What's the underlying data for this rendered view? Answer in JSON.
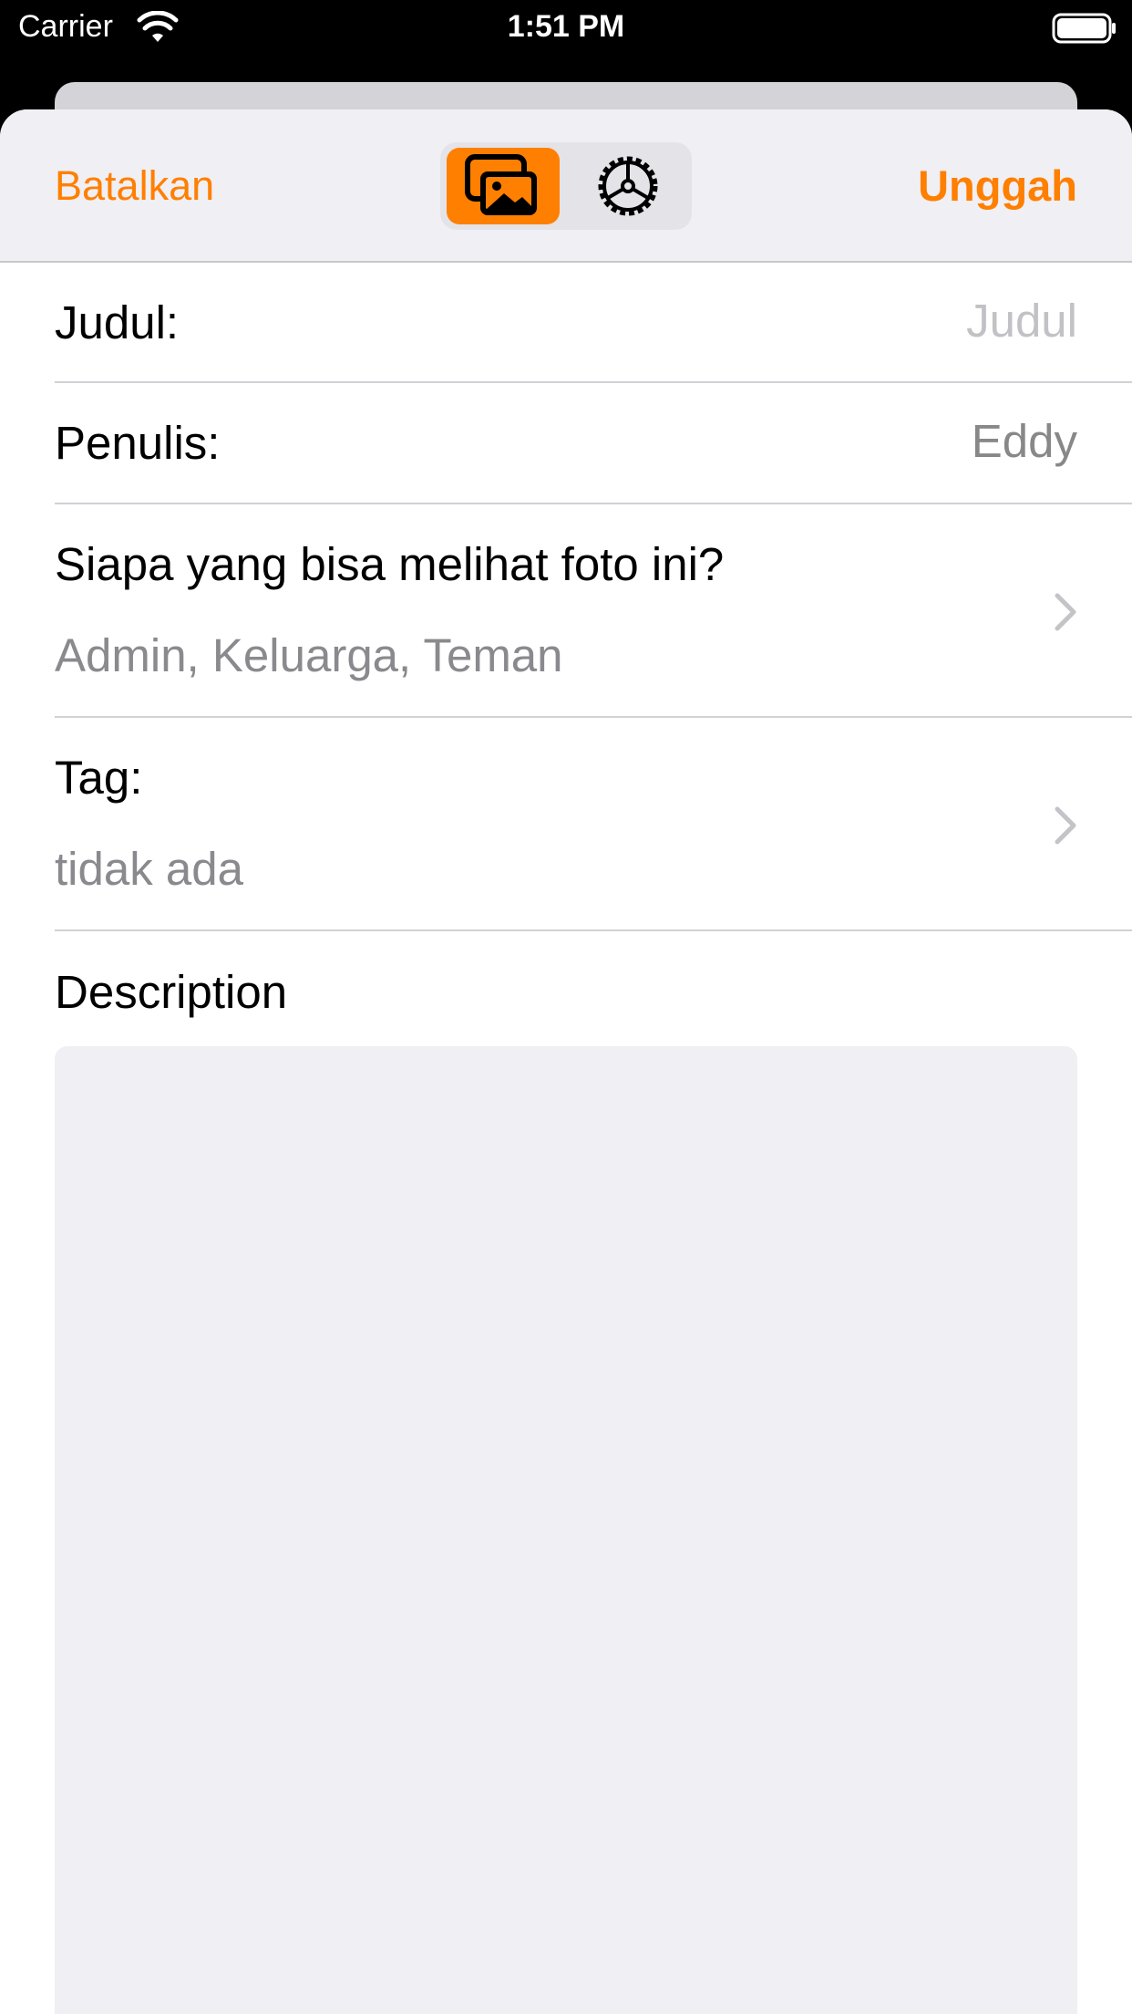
{
  "status_bar": {
    "carrier": "Carrier",
    "time": "1:51 PM",
    "icons": [
      "wifi-icon",
      "battery-icon"
    ]
  },
  "nav": {
    "cancel_label": "Batalkan",
    "upload_label": "Unggah",
    "segments": [
      {
        "icon": "photos-icon",
        "selected": true
      },
      {
        "icon": "gear-icon",
        "selected": false
      }
    ],
    "accent_color": "#ff7f00"
  },
  "form": {
    "title": {
      "label": "Judul:",
      "placeholder": "Judul"
    },
    "author": {
      "label": "Penulis:",
      "value": "Eddy"
    },
    "privacy": {
      "label": "Siapa yang bisa melihat foto ini?",
      "value": "Admin, Keluarga, Teman"
    },
    "tags": {
      "label": "Tag:",
      "value": "tidak ada"
    },
    "description": {
      "label": "Description",
      "value": ""
    }
  }
}
